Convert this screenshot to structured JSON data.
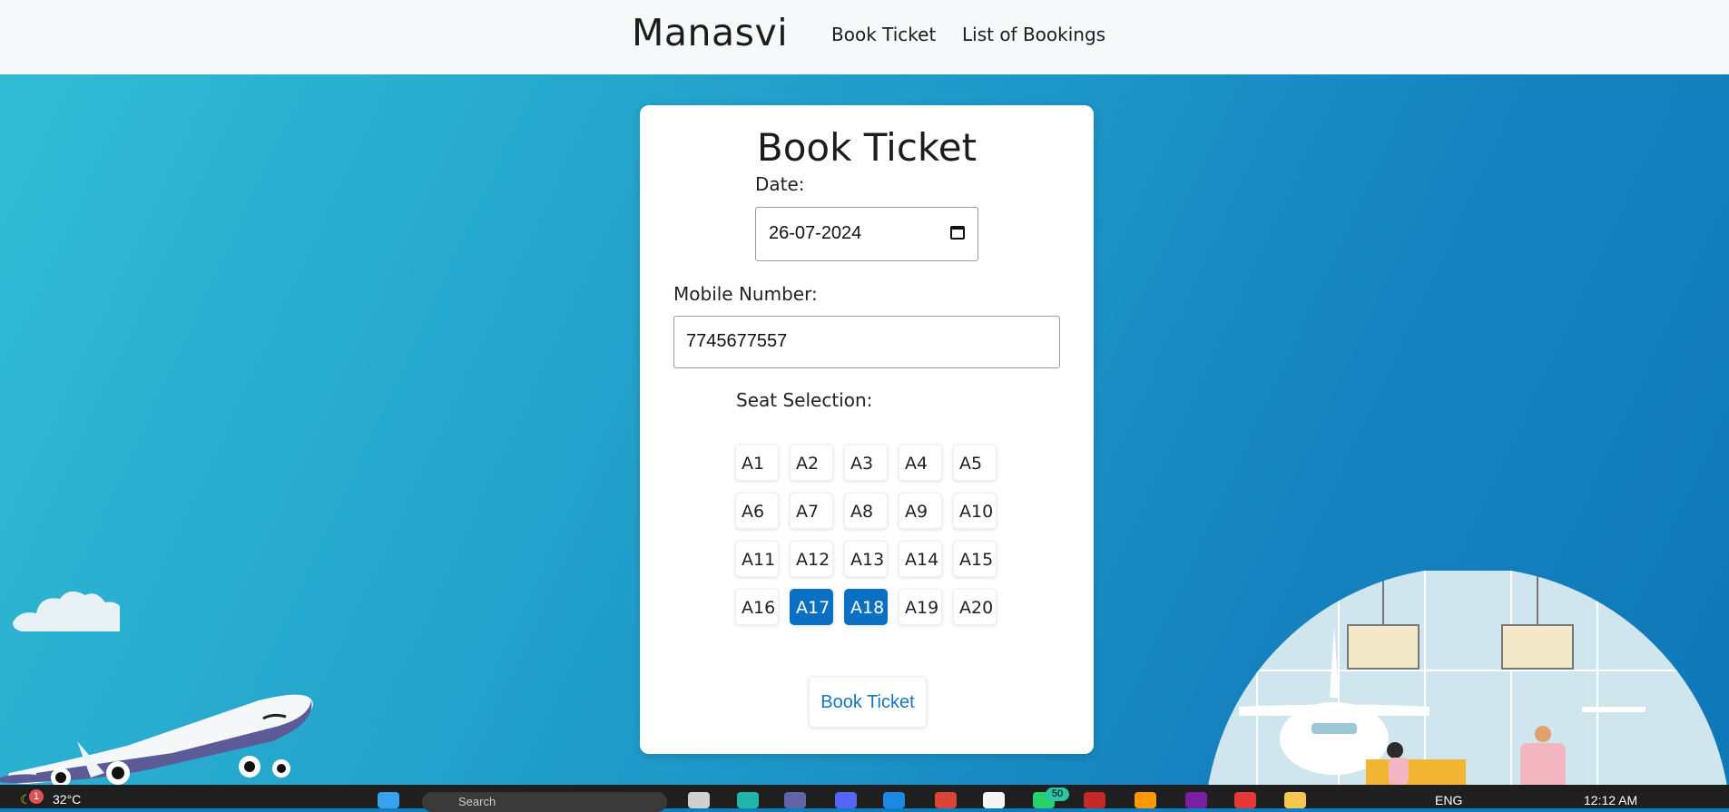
{
  "header": {
    "brand": "Manasvi",
    "nav": [
      "Book Ticket",
      "List of Bookings"
    ]
  },
  "form": {
    "title": "Book Ticket",
    "date_label": "Date:",
    "date_value": "26-07-2024",
    "mobile_label": "Mobile Number:",
    "mobile_value": "7745677557",
    "seat_label": "Seat Selection:",
    "seats": [
      "A1",
      "A2",
      "A3",
      "A4",
      "A5",
      "A6",
      "A7",
      "A8",
      "A9",
      "A10",
      "A11",
      "A12",
      "A13",
      "A14",
      "A15",
      "A16",
      "A17",
      "A18",
      "A19",
      "A20"
    ],
    "selected_seats": [
      "A17",
      "A18"
    ],
    "submit_label": "Book Ticket"
  },
  "taskbar": {
    "weather_badge": "1",
    "temperature": "32°C",
    "search_placeholder": "Search",
    "notification_count": "50",
    "language": "ENG",
    "time": "12:12 AM"
  },
  "colors": {
    "accent": "#0c70c2",
    "button_text": "#1575c0",
    "bg_gradient_start": "#31bcd4",
    "bg_gradient_end": "#0f78b8"
  }
}
